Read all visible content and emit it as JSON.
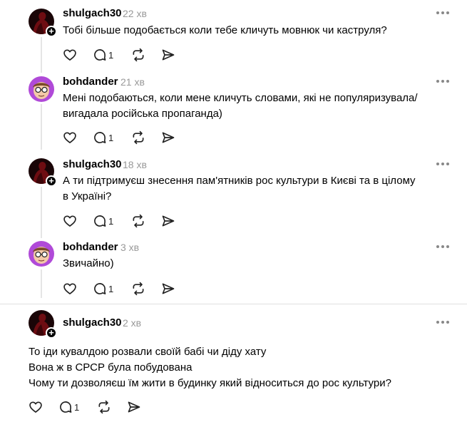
{
  "posts": [
    {
      "username": "shulgach30",
      "time": "22 хв",
      "text": [
        "Тобі більше подобається коли тебе кличуть мовнюк чи каструля?"
      ],
      "reply_count": "1",
      "avatar": "dark-red"
    },
    {
      "username": "bohdander",
      "time": "21 хв",
      "text": [
        "Мені подобаються, коли мене кличуть словами, які не популяризувала/",
        "вигадала російська пропаганда)"
      ],
      "reply_count": "1",
      "avatar": "purple-cartoon"
    },
    {
      "username": "shulgach30",
      "time": "18 хв",
      "text": [
        "А ти підтримуєш знесення пам'ятників рос культури в Києві та в цілому",
        "в Україні?"
      ],
      "reply_count": "1",
      "avatar": "dark-red"
    },
    {
      "username": "bohdander",
      "time": "3 хв",
      "text": [
        "Звичайно)"
      ],
      "reply_count": "1",
      "avatar": "purple-cartoon"
    },
    {
      "username": "shulgach30",
      "time": "2 хв",
      "text": [
        "То іди кувалдою розвали своїй бабі чи діду хату",
        "Вона ж в СРСР була побудована",
        "Чому ти дозволяєш їм жити в будинку який відноситься до рос культури?"
      ],
      "reply_count": "1",
      "avatar": "dark-red"
    }
  ],
  "icons": {
    "like": "heart-icon",
    "reply": "comment-icon",
    "repost": "repost-icon",
    "share": "send-icon",
    "more": "more-options-icon"
  },
  "colors": {
    "meta_gray": "#999999",
    "line_gray": "#e5e5e5"
  }
}
